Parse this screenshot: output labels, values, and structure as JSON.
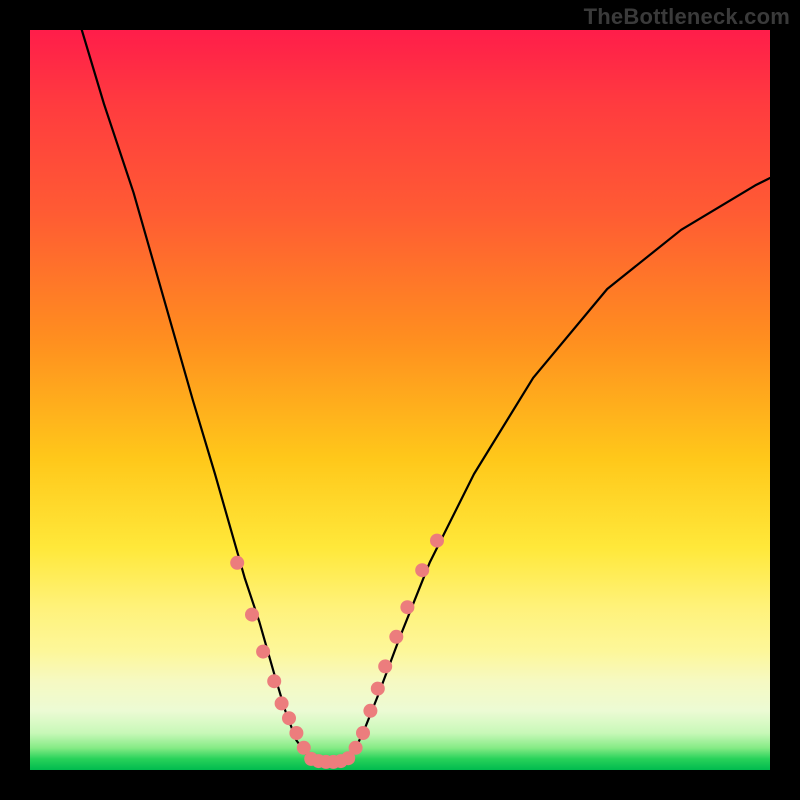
{
  "watermark": "TheBottleneck.com",
  "chart_data": {
    "type": "line",
    "title": "",
    "xlabel": "",
    "ylabel": "",
    "xlim": [
      0,
      100
    ],
    "ylim": [
      0,
      100
    ],
    "note": "V-shaped bottleneck curve over a red→yellow→green vertical gradient. Y-values are approximate percentages of plot height measured from bottom; x is percentage of plot width.",
    "series": [
      {
        "name": "left-branch",
        "x": [
          7,
          10,
          14,
          18,
          22,
          25,
          27,
          29,
          31,
          33,
          34.5,
          36,
          37.5
        ],
        "values": [
          100,
          90,
          78,
          64,
          50,
          40,
          33,
          26,
          20,
          13,
          8,
          4,
          2
        ]
      },
      {
        "name": "trough",
        "x": [
          37.5,
          38.5,
          39.5,
          40.5,
          41.5,
          42.5,
          43.5
        ],
        "values": [
          2,
          1.2,
          1,
          1,
          1,
          1.2,
          2
        ]
      },
      {
        "name": "right-branch",
        "x": [
          43.5,
          45,
          47,
          50,
          54,
          60,
          68,
          78,
          88,
          98,
          100
        ],
        "values": [
          2,
          5,
          10,
          18,
          28,
          40,
          53,
          65,
          73,
          79,
          80
        ]
      },
      {
        "name": "pink-markers-left",
        "type": "scatter",
        "x": [
          28,
          30,
          31.5,
          33,
          34,
          35,
          36,
          37
        ],
        "values": [
          28,
          21,
          16,
          12,
          9,
          7,
          5,
          3
        ]
      },
      {
        "name": "pink-markers-right",
        "type": "scatter",
        "x": [
          44,
          45,
          46,
          47,
          48,
          49.5,
          51,
          53,
          55
        ],
        "values": [
          3,
          5,
          8,
          11,
          14,
          18,
          22,
          27,
          31
        ]
      },
      {
        "name": "pink-markers-trough",
        "type": "scatter",
        "x": [
          38,
          39,
          40,
          41,
          42,
          43
        ],
        "values": [
          1.5,
          1.2,
          1.1,
          1.1,
          1.2,
          1.6
        ]
      }
    ],
    "colors": {
      "curve": "#000000",
      "markers": "#ec7d7d",
      "gradient_top": "#ff1d4a",
      "gradient_mid": "#ffe83a",
      "gradient_bottom": "#00bb4f",
      "frame": "#000000"
    }
  }
}
